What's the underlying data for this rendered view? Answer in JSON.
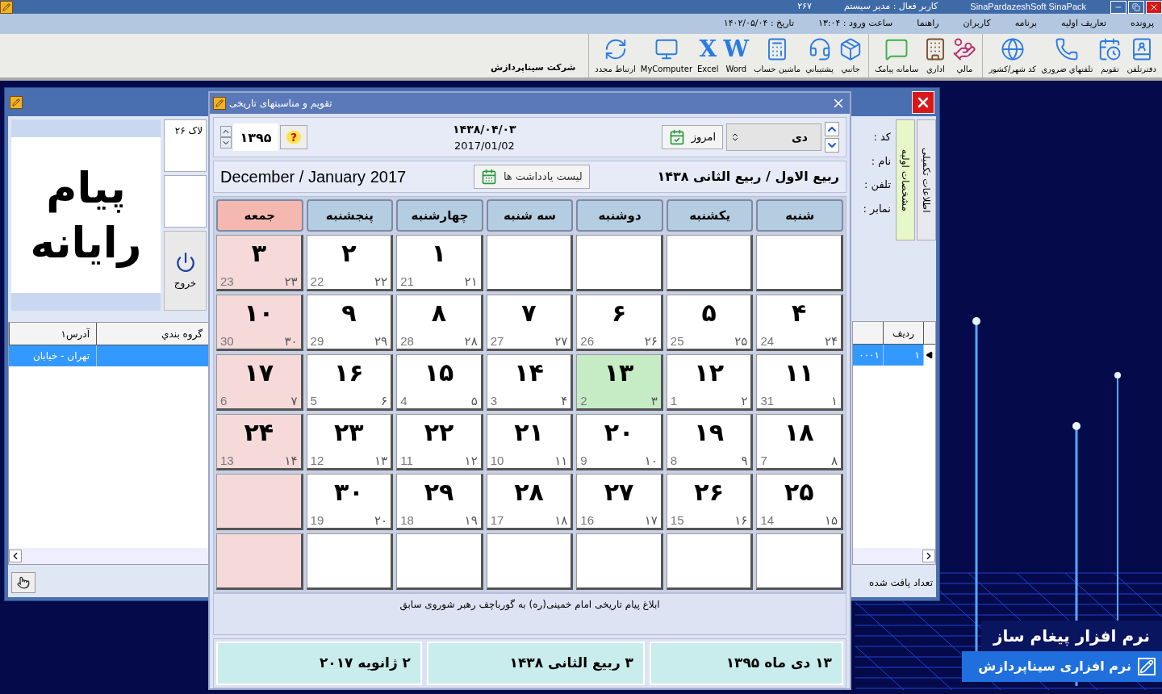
{
  "app": {
    "title": "SinaPardazeshSoft SinaPack",
    "active_user": "کاربر فعال : مدیر سیستم",
    "code": "۲۶۷"
  },
  "menu": {
    "items": [
      "پرونده",
      "تعاریف اولیه",
      "برنامه",
      "کاربران",
      "راهنما"
    ],
    "login_time": "ساعت ورود : ۱۳:۰۴",
    "date": "تاریخ : ۱۴۰۲/۰۵/۰۴"
  },
  "toolbar": {
    "groups": [
      {
        "items": [
          {
            "label": "دفترتلفن"
          },
          {
            "label": "تقویم"
          },
          {
            "label": "تلفنهاي ضروري"
          },
          {
            "label": "کد شهر/کشور"
          }
        ]
      },
      {
        "items": [
          {
            "label": "مالي"
          },
          {
            "label": "اداري"
          },
          {
            "label": "سامانه پيامک"
          }
        ]
      },
      {
        "items": [
          {
            "label": "جانبي"
          },
          {
            "label": "پشتيباني"
          },
          {
            "label": "ماشين حساب"
          },
          {
            "label": "Word",
            "glyph": "W"
          },
          {
            "label": "Excel",
            "glyph": "X"
          },
          {
            "label": "MyComputer"
          },
          {
            "label": "ارتباط مجدد"
          }
        ]
      }
    ],
    "company": "شرکت سیناپردازش"
  },
  "main_window": {
    "logo": [
      "پیام",
      "رایانه"
    ],
    "field_1": "لاک ۲۶",
    "exit_button": "خروج",
    "left_table": {
      "columns": [
        "گروه بندي",
        "آدرس۱"
      ],
      "row": [
        "تهران - خيابان"
      ]
    },
    "tabs": [
      {
        "label": "اطلاعات تکمیلی",
        "selected": false
      },
      {
        "label": "مشخصات اولیه",
        "selected": true
      }
    ],
    "labels": [
      "کد :",
      "نام :",
      "تلفن :",
      "نمابر :"
    ],
    "right_table": {
      "columns": [
        "ردیف"
      ],
      "row": [
        "۱",
        "۰۰۰۱"
      ]
    },
    "footer": "تعداد یافت شده"
  },
  "calendar": {
    "title": "تقویم و مناسبتهای تاریخی",
    "year": "۱۳۹۵",
    "help": "?",
    "hijri_date": "۱۴۳۸/۰۴/۰۳",
    "gregorian_date": "2017/01/02",
    "today_button": "امروز",
    "month": "دی",
    "gregorian_months": "December / January 2017",
    "notes_button": "لیست یادداشت ها",
    "hijri_months": "ربیع الاول / ربیع الثانی ۱۴۳۸",
    "weekdays": [
      {
        "label": "شنبه",
        "holiday": false
      },
      {
        "label": "یکشنبه",
        "holiday": false
      },
      {
        "label": "دوشنبه",
        "holiday": false
      },
      {
        "label": "سه شنبه",
        "holiday": false
      },
      {
        "label": "چهارشنبه",
        "holiday": false
      },
      {
        "label": "پنجشنبه",
        "holiday": false
      },
      {
        "label": "جمعه",
        "holiday": true
      }
    ],
    "weeks": [
      {
        "cells": [
          {
            "kind": "blank"
          },
          {
            "kind": "blank"
          },
          {
            "kind": "blank"
          },
          {
            "kind": "blank"
          },
          {
            "kind": "date",
            "day": "۱",
            "gregorian": "21",
            "hijri": "۲۱",
            "selected": false
          },
          {
            "kind": "date",
            "day": "۲",
            "gregorian": "22",
            "hijri": "۲۲",
            "selected": false
          },
          {
            "kind": "date",
            "day": "۳",
            "gregorian": "23",
            "hijri": "۲۳",
            "selected": false
          }
        ]
      },
      {
        "cells": [
          {
            "kind": "date",
            "day": "۴",
            "gregorian": "24",
            "hijri": "۲۴",
            "selected": false
          },
          {
            "kind": "date",
            "day": "۵",
            "gregorian": "25",
            "hijri": "۲۵",
            "selected": false
          },
          {
            "kind": "date",
            "day": "۶",
            "gregorian": "26",
            "hijri": "۲۶",
            "selected": false
          },
          {
            "kind": "date",
            "day": "۷",
            "gregorian": "27",
            "hijri": "۲۷",
            "selected": false
          },
          {
            "kind": "date",
            "day": "۸",
            "gregorian": "28",
            "hijri": "۲۸",
            "selected": false
          },
          {
            "kind": "date",
            "day": "۹",
            "gregorian": "29",
            "hijri": "۲۹",
            "selected": false
          },
          {
            "kind": "date",
            "day": "۱۰",
            "gregorian": "30",
            "hijri": "۳۰",
            "selected": false
          }
        ]
      },
      {
        "cells": [
          {
            "kind": "date",
            "day": "۱۱",
            "gregorian": "31",
            "hijri": "۱",
            "selected": false
          },
          {
            "kind": "date",
            "day": "۱۲",
            "gregorian": "1",
            "hijri": "۲",
            "selected": false
          },
          {
            "kind": "date",
            "day": "۱۳",
            "gregorian": "2",
            "hijri": "۳",
            "selected": true
          },
          {
            "kind": "date",
            "day": "۱۴",
            "gregorian": "3",
            "hijri": "۴",
            "selected": false
          },
          {
            "kind": "date",
            "day": "۱۵",
            "gregorian": "4",
            "hijri": "۵",
            "selected": false
          },
          {
            "kind": "date",
            "day": "۱۶",
            "gregorian": "5",
            "hijri": "۶",
            "selected": false
          },
          {
            "kind": "date",
            "day": "۱۷",
            "gregorian": "6",
            "hijri": "۷",
            "selected": false
          }
        ]
      },
      {
        "cells": [
          {
            "kind": "date",
            "day": "۱۸",
            "gregorian": "7",
            "hijri": "۸",
            "selected": false
          },
          {
            "kind": "date",
            "day": "۱۹",
            "gregorian": "8",
            "hijri": "۹",
            "selected": false
          },
          {
            "kind": "date",
            "day": "۲۰",
            "gregorian": "9",
            "hijri": "۱۰",
            "selected": false
          },
          {
            "kind": "date",
            "day": "۲۱",
            "gregorian": "10",
            "hijri": "۱۱",
            "selected": false
          },
          {
            "kind": "date",
            "day": "۲۲",
            "gregorian": "11",
            "hijri": "۱۲",
            "selected": false
          },
          {
            "kind": "date",
            "day": "۲۳",
            "gregorian": "12",
            "hijri": "۱۳",
            "selected": false
          },
          {
            "kind": "date",
            "day": "۲۴",
            "gregorian": "13",
            "hijri": "۱۴",
            "selected": false
          }
        ]
      },
      {
        "cells": [
          {
            "kind": "date",
            "day": "۲۵",
            "gregorian": "14",
            "hijri": "۱۵",
            "selected": false
          },
          {
            "kind": "date",
            "day": "۲۶",
            "gregorian": "15",
            "hijri": "۱۶",
            "selected": false
          },
          {
            "kind": "date",
            "day": "۲۷",
            "gregorian": "16",
            "hijri": "۱۷",
            "selected": false
          },
          {
            "kind": "date",
            "day": "۲۸",
            "gregorian": "17",
            "hijri": "۱۸",
            "selected": false
          },
          {
            "kind": "date",
            "day": "۲۹",
            "gregorian": "18",
            "hijri": "۱۹",
            "selected": false
          },
          {
            "kind": "date",
            "day": "۳۰",
            "gregorian": "19",
            "hijri": "۲۰",
            "selected": false
          },
          {
            "kind": "blank"
          }
        ]
      },
      {
        "cells": [
          {
            "kind": "blank"
          },
          {
            "kind": "blank"
          },
          {
            "kind": "blank"
          },
          {
            "kind": "blank"
          },
          {
            "kind": "blank"
          },
          {
            "kind": "blank"
          },
          {
            "kind": "blank"
          }
        ]
      }
    ],
    "occasion": "ابلاغ پیام تاریخی امام خمینی(ره) به گورباچف رهبر شوروی سابق",
    "summary": [
      "۱۳ دی ماه ۱۳۹۵",
      "۳ ربیع الثانی ۱۴۳۸",
      "۲ ژانویه ۲۰۱۷"
    ]
  },
  "promo": {
    "line_1": "نرم افزار  پیغام ساز",
    "line_2": "نرم افزاری سیناپردازش"
  }
}
